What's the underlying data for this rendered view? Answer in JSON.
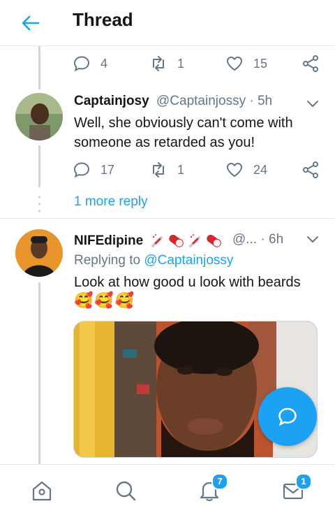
{
  "header": {
    "title": "Thread"
  },
  "prev_tweet_actions": {
    "replies": "4",
    "retweets": "1",
    "likes": "15"
  },
  "tweet1": {
    "display_name": "Captainjosy",
    "handle": "@Captainjossy",
    "time": "5h",
    "text": "Well, she obviously can't come with someone as retarded as you!",
    "replies": "17",
    "retweets": "1",
    "likes": "24"
  },
  "more_replies": {
    "label": "1 more reply"
  },
  "tweet2": {
    "display_name": "NIFEdipine",
    "handle_truncated": "@...",
    "time": "6h",
    "replying_prefix": "Replying to",
    "replying_handle": "@Captainjossy",
    "text": "Look at how good u look with beards",
    "emoji": "🥰🥰🥰"
  },
  "tabbar": {
    "notifications_badge": "7",
    "messages_badge": "1"
  },
  "colors": {
    "accent": "#1da1f2",
    "secondary_text": "#657786",
    "divider": "#e1e8ed"
  }
}
